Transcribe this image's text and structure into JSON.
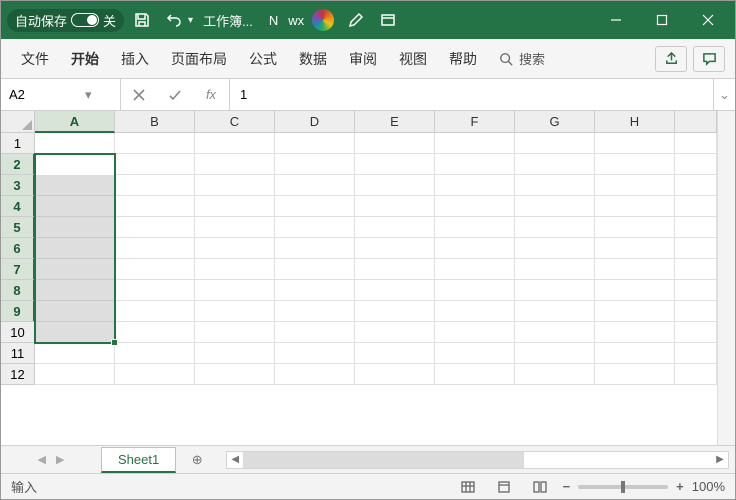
{
  "titlebar": {
    "auto_save_label": "自动保存",
    "auto_save_state": "关",
    "doc_title": "工作簿...",
    "user_prefix": "N",
    "user_name": "wx"
  },
  "ribbon": {
    "tabs": [
      "文件",
      "开始",
      "插入",
      "页面布局",
      "公式",
      "数据",
      "审阅",
      "视图",
      "帮助"
    ],
    "search_placeholder": "搜索"
  },
  "formula_bar": {
    "name_box": "A2",
    "formula_value": "1",
    "fx_label": "fx"
  },
  "grid": {
    "columns": [
      "A",
      "B",
      "C",
      "D",
      "E",
      "F",
      "G",
      "H"
    ],
    "rows": [
      1,
      2,
      3,
      4,
      5,
      6,
      7,
      8,
      9,
      10,
      11,
      12
    ],
    "selected_column_index": 0,
    "selected_row_start": 2,
    "selected_row_end": 9,
    "active_cell_value": "1"
  },
  "sheet_bar": {
    "active_sheet": "Sheet1",
    "add_label": "⊕"
  },
  "status": {
    "mode": "输入",
    "zoom_label": "100%"
  }
}
